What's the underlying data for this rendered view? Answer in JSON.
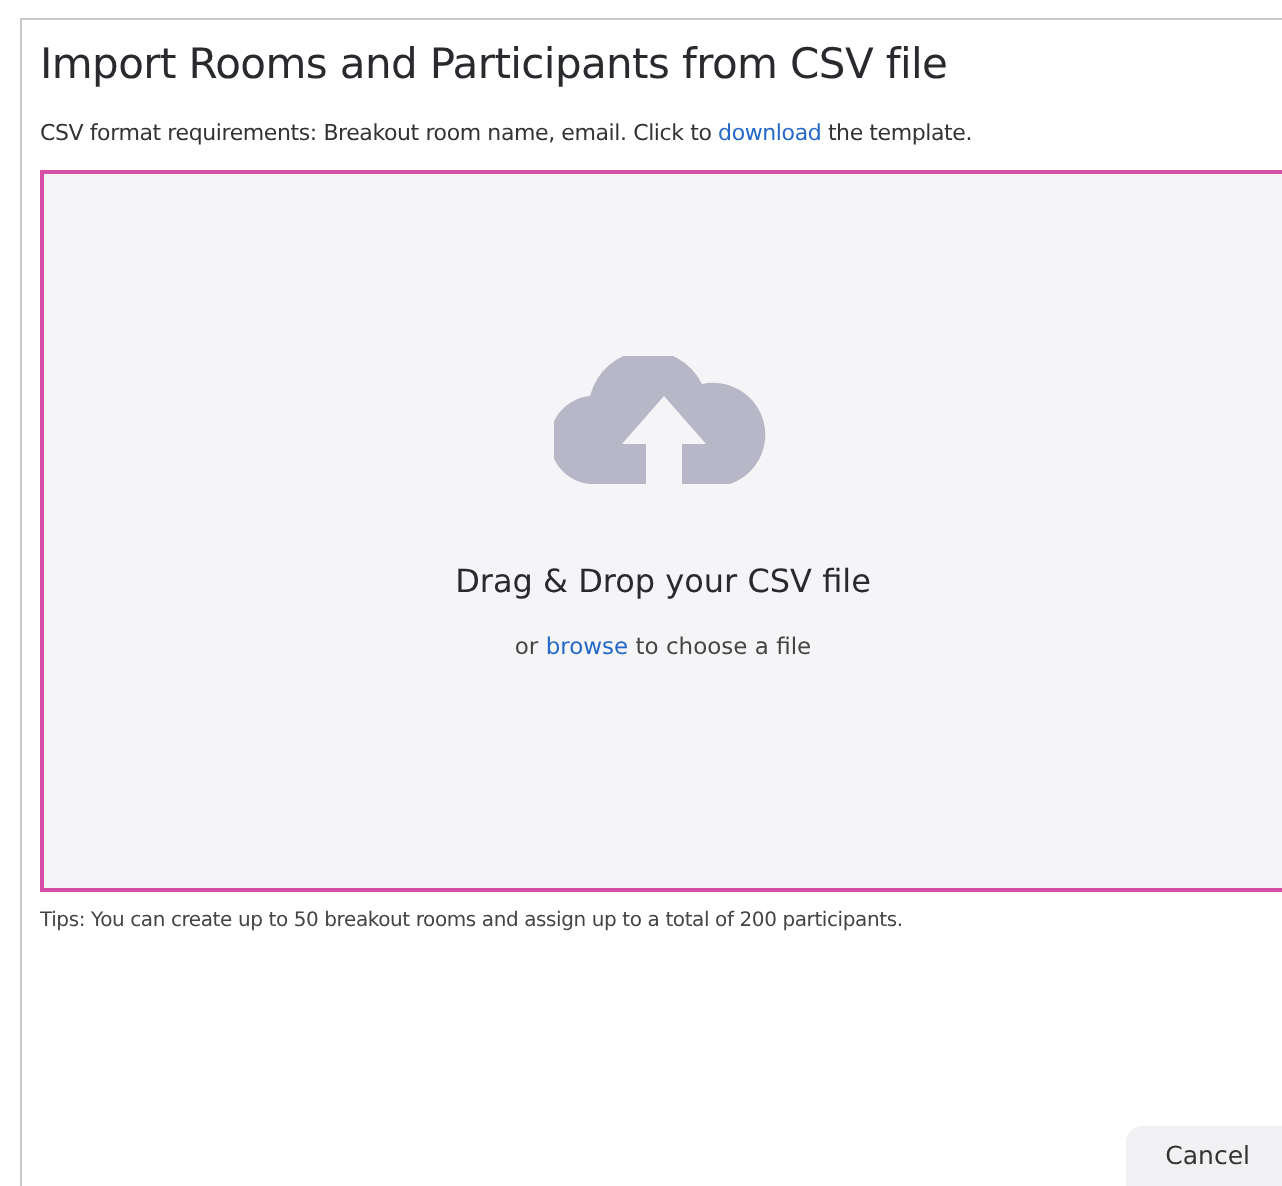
{
  "dialog": {
    "title": "Import Rooms and Participants from CSV file",
    "requirements": {
      "before": "CSV format requirements: Breakout room name, email. Click to",
      "link": "download",
      "after": "the template."
    },
    "drop_zone": {
      "heading": "Drag & Drop your CSV file",
      "before": "or",
      "link": "browse",
      "after": "to choose a file"
    },
    "tips": "Tips: You can create up to 50 breakout rooms and assign up to a total of 200 participants.",
    "buttons": [
      "Cancel"
    ]
  }
}
